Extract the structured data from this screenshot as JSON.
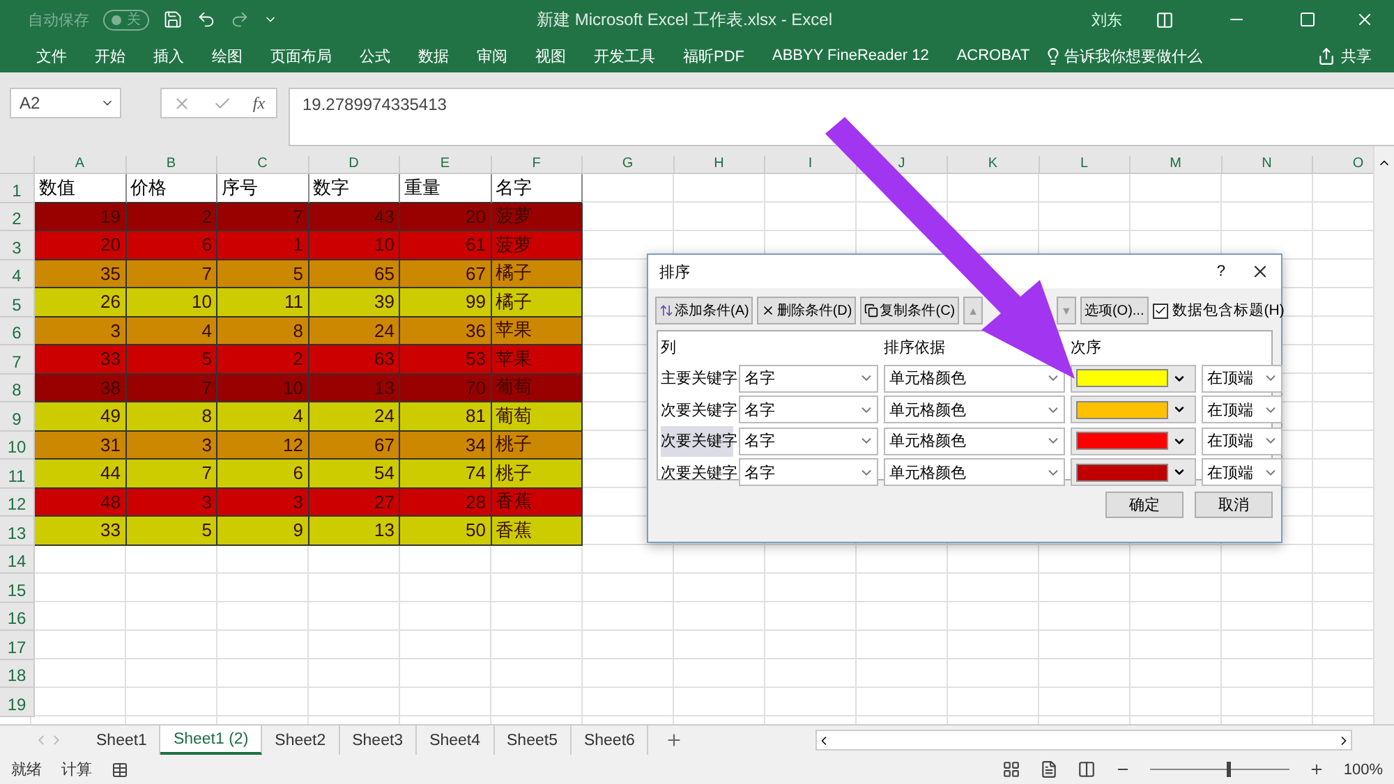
{
  "titlebar": {
    "autosave_label": "自动保存",
    "autosave": {
      "on": false,
      "label": "关"
    },
    "title": "新建 Microsoft Excel 工作表.xlsx  -  Excel",
    "user": "刘东"
  },
  "ribbon_tabs": [
    "文件",
    "开始",
    "插入",
    "绘图",
    "页面布局",
    "公式",
    "数据",
    "审阅",
    "视图",
    "开发工具",
    "福昕PDF",
    "ABBYY FineReader 12",
    "ACROBAT"
  ],
  "tell_me": "告诉我你想要做什么",
  "share": "共享",
  "name_box": "A2",
  "fx": "fx",
  "formula": "19.2789974335413",
  "columns": [
    "A",
    "B",
    "C",
    "D",
    "E",
    "F",
    "G",
    "H",
    "I",
    "J",
    "K",
    "L",
    "M",
    "N",
    "O"
  ],
  "row_numbers": [
    "1",
    "2",
    "3",
    "4",
    "5",
    "6",
    "7",
    "8",
    "9",
    "10",
    "11",
    "12",
    "13",
    "14",
    "15",
    "16",
    "17",
    "18",
    "19"
  ],
  "header_cells": [
    "数值",
    "价格",
    "序号",
    "数字",
    "重量",
    "名字"
  ],
  "rows": [
    {
      "color": "#990000",
      "cells": [
        "19",
        "2",
        "7",
        "43",
        "20",
        "菠萝"
      ]
    },
    {
      "color": "#cc0000",
      "cells": [
        "20",
        "6",
        "1",
        "10",
        "61",
        "菠萝"
      ]
    },
    {
      "color": "#cc8800",
      "cells": [
        "35",
        "7",
        "5",
        "65",
        "67",
        "橘子"
      ]
    },
    {
      "color": "#cccc00",
      "cells": [
        "26",
        "10",
        "11",
        "39",
        "99",
        "橘子"
      ]
    },
    {
      "color": "#cc8800",
      "cells": [
        "3",
        "4",
        "8",
        "24",
        "36",
        "苹果"
      ]
    },
    {
      "color": "#cc0000",
      "cells": [
        "33",
        "5",
        "2",
        "63",
        "53",
        "苹果"
      ]
    },
    {
      "color": "#990000",
      "cells": [
        "38",
        "7",
        "10",
        "13",
        "70",
        "葡萄"
      ]
    },
    {
      "color": "#cccc00",
      "cells": [
        "49",
        "8",
        "4",
        "24",
        "81",
        "葡萄"
      ]
    },
    {
      "color": "#cc8800",
      "cells": [
        "31",
        "3",
        "12",
        "67",
        "34",
        "桃子"
      ]
    },
    {
      "color": "#cccc00",
      "cells": [
        "44",
        "7",
        "6",
        "54",
        "74",
        "桃子"
      ]
    },
    {
      "color": "#cc0000",
      "cells": [
        "48",
        "3",
        "3",
        "27",
        "28",
        "香蕉"
      ]
    },
    {
      "color": "#cccc00",
      "cells": [
        "33",
        "5",
        "9",
        "13",
        "50",
        "香蕉"
      ]
    }
  ],
  "dialog": {
    "title": "排序",
    "help": "?",
    "add": "添加条件(A)",
    "delete": "删除条件(D)",
    "copy": "复制条件(C)",
    "move_up": "▲",
    "move_down": "▼",
    "options": "选项(O)...",
    "has_headers": {
      "label": "数据包含标题(H)",
      "checked": true
    },
    "col_headers": [
      "列",
      "排序依据",
      "次序"
    ],
    "levels": [
      {
        "label": "主要关键字",
        "column": "名字",
        "sort_on": "单元格颜色",
        "color": "#ffff00",
        "position": "在顶端",
        "selected": false
      },
      {
        "label": "次要关键字",
        "column": "名字",
        "sort_on": "单元格颜色",
        "color": "#ffc000",
        "position": "在顶端",
        "selected": false
      },
      {
        "label": "次要关键字",
        "column": "名字",
        "sort_on": "单元格颜色",
        "color": "#ff0000",
        "position": "在顶端",
        "selected": true
      },
      {
        "label": "次要关键字",
        "column": "名字",
        "sort_on": "单元格颜色",
        "color": "#c00000",
        "position": "在顶端",
        "selected": false
      }
    ],
    "ok": "确定",
    "cancel": "取消"
  },
  "sheet_tabs": [
    {
      "label": "Sheet1",
      "selected": false
    },
    {
      "label": "Sheet1 (2)",
      "selected": true
    },
    {
      "label": "Sheet2",
      "selected": false
    },
    {
      "label": "Sheet3",
      "selected": false
    },
    {
      "label": "Sheet4",
      "selected": false
    },
    {
      "label": "Sheet5",
      "selected": false
    },
    {
      "label": "Sheet6",
      "selected": false
    }
  ],
  "status": {
    "ready": "就绪",
    "calc": "计算",
    "zoom_slider": {
      "level": 0.55
    },
    "zoom": "100%"
  }
}
